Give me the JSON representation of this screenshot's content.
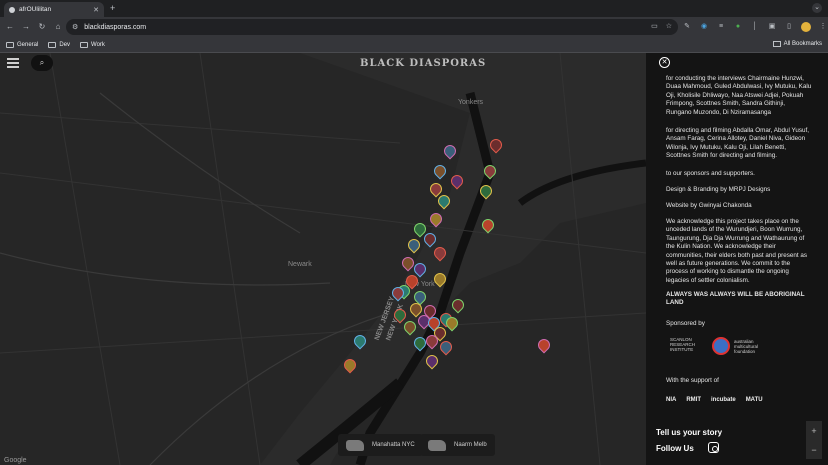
{
  "browser": {
    "tab_title": "afrOUlilitan",
    "new_tab": "+",
    "url": "blackdiasporas.com",
    "bookmarks": [
      "General",
      "Dev",
      "Work"
    ],
    "all_bookmarks": "All Bookmarks"
  },
  "map": {
    "logo": "BLACK DIASPORAS",
    "labels": {
      "yonkers": "Yonkers",
      "newark": "Newark",
      "new_york": "New York",
      "nj": "NEW JERSEY",
      "ny": "NEW YORK"
    },
    "google": "Google",
    "buttons": [
      {
        "label": "Manahatta NYC"
      },
      {
        "label": "Naarm Melb"
      }
    ]
  },
  "panel": {
    "p1": "for conducting the interviews Chairmaine Hunzwi, Duaa Mahmoud, Guled Abdulwasi, Ivy Mutuku, Kalu Oji, Kholisile Dhliwayo, Naa Atswei Adjei, Pokuah Frimpong, Scottnes Smith, Sandra Githinji, Rungano Muzondo, Di Nziramasanga",
    "p2": "for directing and filming Abdalla Omar, Abdul Yusuf, Ansam Farag, Cerina Allotey, Daniel Niva, Gideon Wilonja, Ivy Mutuku, Kalu Oji, Lilah Benetti, Scottnes Smith for directing and filming.",
    "p3": "to our sponsors and supporters.",
    "p4": "Design & Branding by MRPJ Designs",
    "p5": "Website by Gwinyai Chakonda",
    "p6": "We acknowledge this project takes place on the unceded lands of the Wurundjeri, Boon Wurrung, Taungurung, Dja Dja Wurrung and Wathaurung of the Kulin Nation. We acknowledge their communities, their elders both past and present as well as future generations. We commit to the process of working to dismantle the ongoing legacies of settler colonialism.",
    "p7": "ALWAYS WAS ALWAYS WILL BE ABORIGINAL LAND",
    "sponsored": "Sponsored by",
    "sponsor1": "SCANLON RESEARCH INSTITUTE",
    "sponsor2": "australian multicultural foundation",
    "support": "With the support of",
    "logos": [
      "NIA",
      "RMIT",
      "incubate",
      "MATU"
    ],
    "tell": "Tell us your story",
    "follow": "Follow Us",
    "zoom_in": "+",
    "zoom_out": "−"
  }
}
